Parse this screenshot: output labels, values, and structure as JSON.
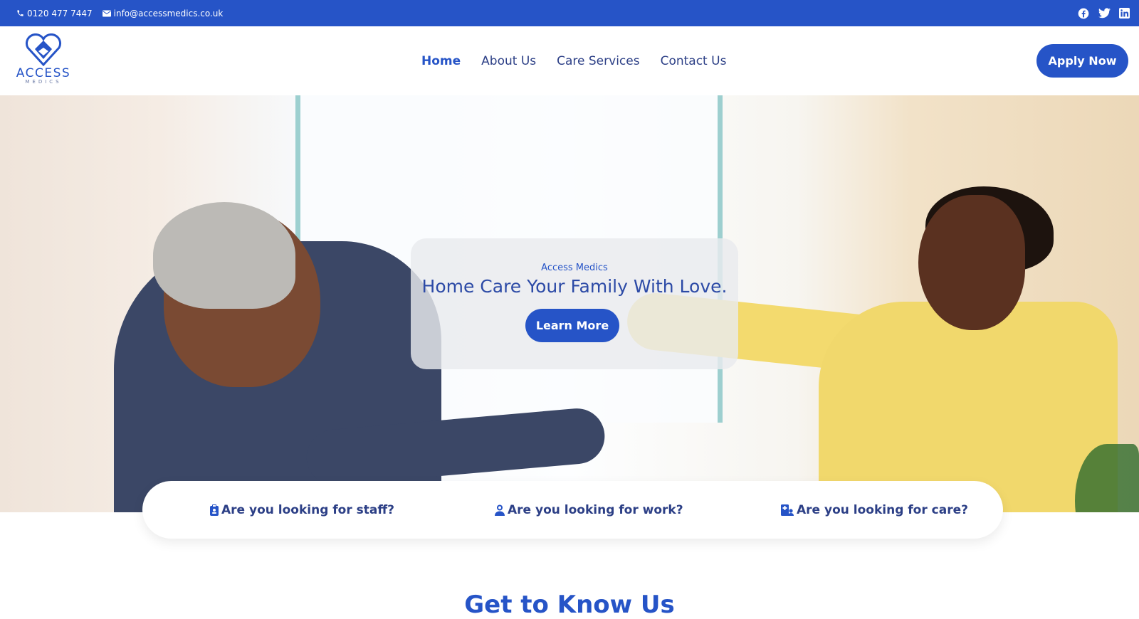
{
  "topbar": {
    "phone": "0120 477 7447",
    "email": "info@accessmedics.co.uk",
    "social": [
      "facebook-icon",
      "twitter-icon",
      "linkedin-icon"
    ]
  },
  "logo": {
    "word": "ACCESS",
    "sub": "MEDICS"
  },
  "nav": {
    "items": [
      {
        "label": "Home",
        "active": true
      },
      {
        "label": "About Us",
        "active": false
      },
      {
        "label": "Care Services",
        "active": false
      },
      {
        "label": "Contact Us",
        "active": false
      }
    ],
    "apply_label": "Apply Now"
  },
  "hero": {
    "kicker": "Access Medics",
    "headline": "Home Care Your Family With Love.",
    "button_label": "Learn More"
  },
  "quick_links": [
    {
      "label": "Are you looking for staff?",
      "icon": "clipboard-icon"
    },
    {
      "label": "Are you looking for work?",
      "icon": "user-icon"
    },
    {
      "label": "Are you looking for care?",
      "icon": "hospital-user-icon"
    }
  ],
  "section": {
    "title": "Get to Know Us"
  },
  "colors": {
    "brand": "#2654c7",
    "text_dark": "#2c3f86"
  }
}
